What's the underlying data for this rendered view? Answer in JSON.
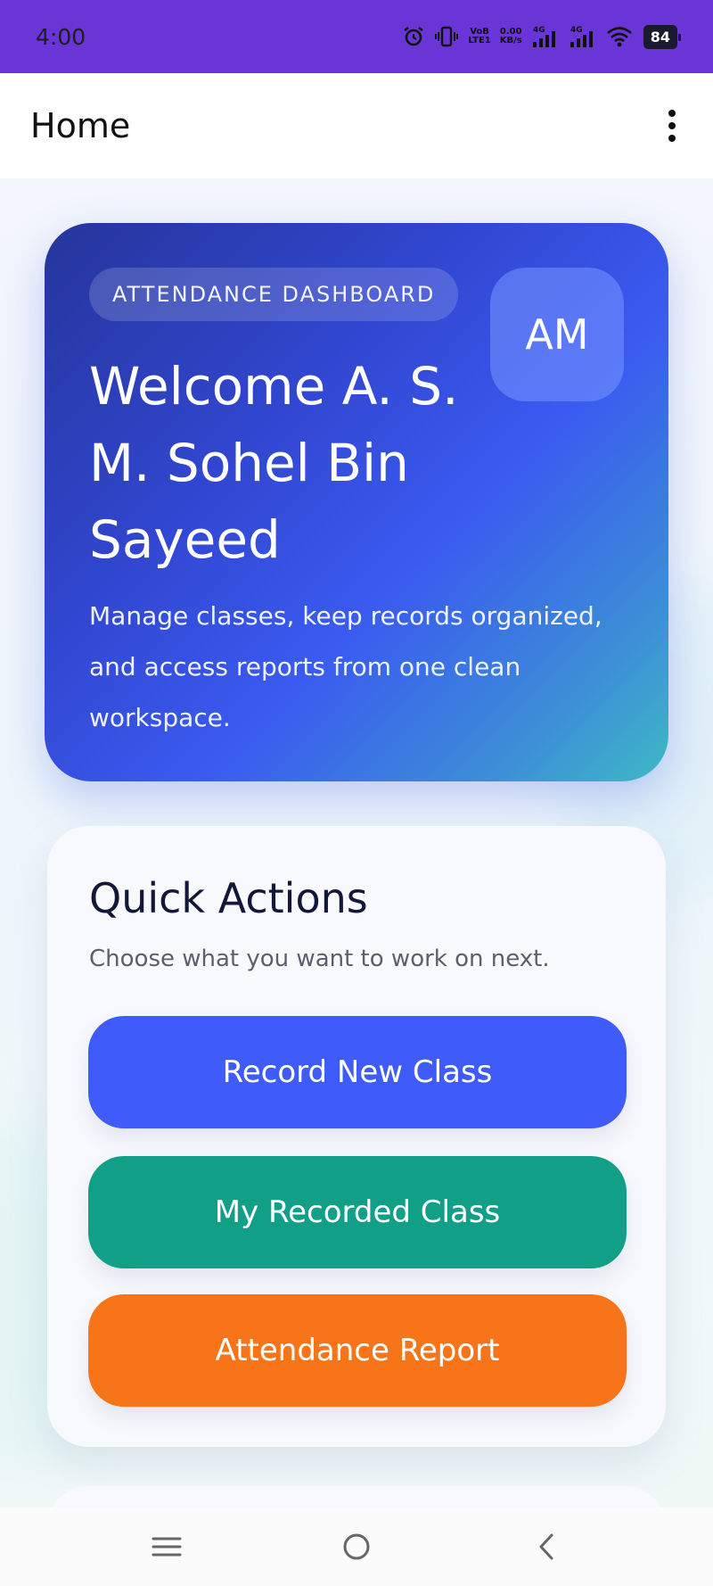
{
  "status_bar": {
    "time": "4:00",
    "icons": [
      "alarm-icon",
      "vibrate-icon",
      "volte-icon",
      "data-speed-icon",
      "signal-4g-icon",
      "signal-4g-icon",
      "wifi-icon",
      "battery-icon"
    ],
    "volte_top": "VoB",
    "volte_bottom": "LTE1",
    "speed_top": "0.00",
    "speed_bottom": "KB/s",
    "net1": "4G",
    "net2": "4G",
    "battery": "84"
  },
  "app_bar": {
    "title": "Home",
    "menu_icon": "more-vert-icon"
  },
  "hero": {
    "badge": "ATTENDANCE DASHBOARD",
    "avatar_initials": "AM",
    "title": "Welcome A. S. M. Sohel Bin Sayeed",
    "subtitle": "Manage classes, keep records organized, and access reports from one clean workspace."
  },
  "quick_actions": {
    "title": "Quick Actions",
    "subtitle": "Choose what you want to work on next.",
    "buttons": [
      {
        "label": "Record New Class",
        "color": "#3f5cfa"
      },
      {
        "label": "My Recorded Class",
        "color": "#11a087"
      },
      {
        "label": "Attendance Report",
        "color": "#f77418"
      }
    ]
  },
  "nav_bar": {
    "items": [
      "menu-icon",
      "home-circle-icon",
      "back-icon"
    ]
  },
  "colors": {
    "status_bar": "#6a35d6",
    "hero_start": "#25369a",
    "hero_end": "#3fb9c6"
  }
}
